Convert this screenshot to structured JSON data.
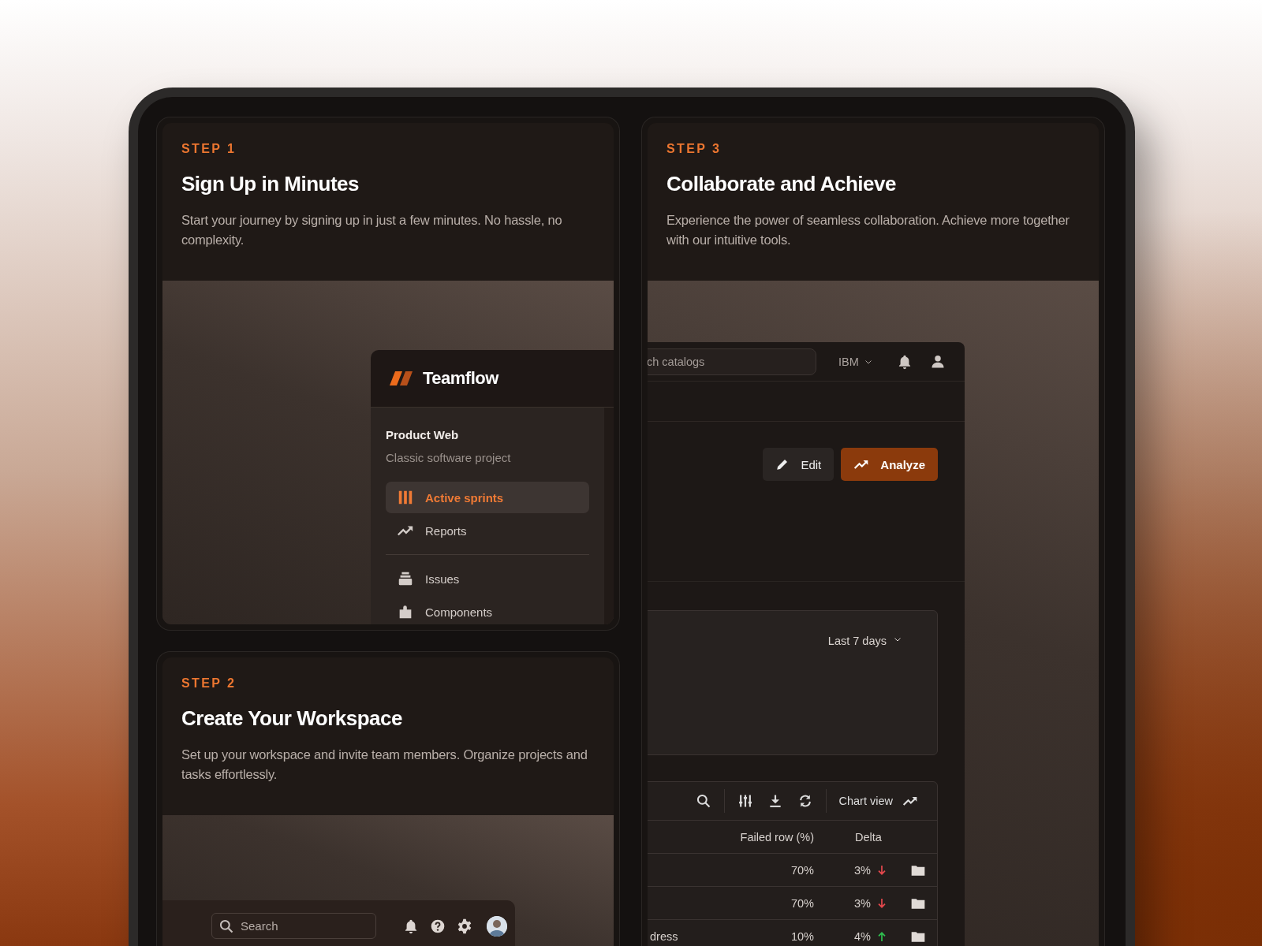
{
  "left_column": [
    {
      "step": "STEP 1",
      "title": "Sign Up in Minutes",
      "description": "Start your journey by signing up in just a few minutes. No hassle, no complexity.",
      "preview": {
        "kind": "sidebar",
        "brand": "Teamflow",
        "project_name": "Product Web",
        "project_type": "Classic software project",
        "nav": [
          {
            "label": "Active sprints",
            "selected": true
          },
          {
            "label": "Reports",
            "selected": false
          }
        ],
        "nav_more": [
          {
            "label": "Issues",
            "selected": false
          },
          {
            "label": "Components",
            "selected": false
          }
        ]
      }
    },
    {
      "step": "STEP 2",
      "title": "Create Your Workspace",
      "description": "Set up your workspace and invite team members. Organize projects and tasks effortlessly.",
      "preview": {
        "kind": "topbar",
        "search": {
          "placeholder": "Search"
        }
      }
    }
  ],
  "right_column": [
    {
      "step": "STEP 3",
      "title": "Collaborate and Achieve",
      "description": "Experience the power of seamless collaboration. Achieve more together with our intuitive tools.",
      "preview": {
        "kind": "dashboard",
        "search": {
          "placeholder": "ch catalogs"
        },
        "account": "IBM",
        "actions": [
          {
            "label": "Edit",
            "kind": "secondary"
          },
          {
            "label": "Analyze",
            "kind": "primary"
          }
        ],
        "range": "Last 7 days",
        "toolbar_label": "Chart view",
        "columns": [
          "Failed row (%)",
          "Delta"
        ],
        "rows": [
          {
            "failed": "70%",
            "delta": "3%",
            "rising": false
          },
          {
            "failed": "70%",
            "delta": "3%",
            "rising": false
          },
          {
            "name": "dress",
            "failed": "10%",
            "delta": "4%",
            "rising": true
          }
        ]
      }
    }
  ]
}
